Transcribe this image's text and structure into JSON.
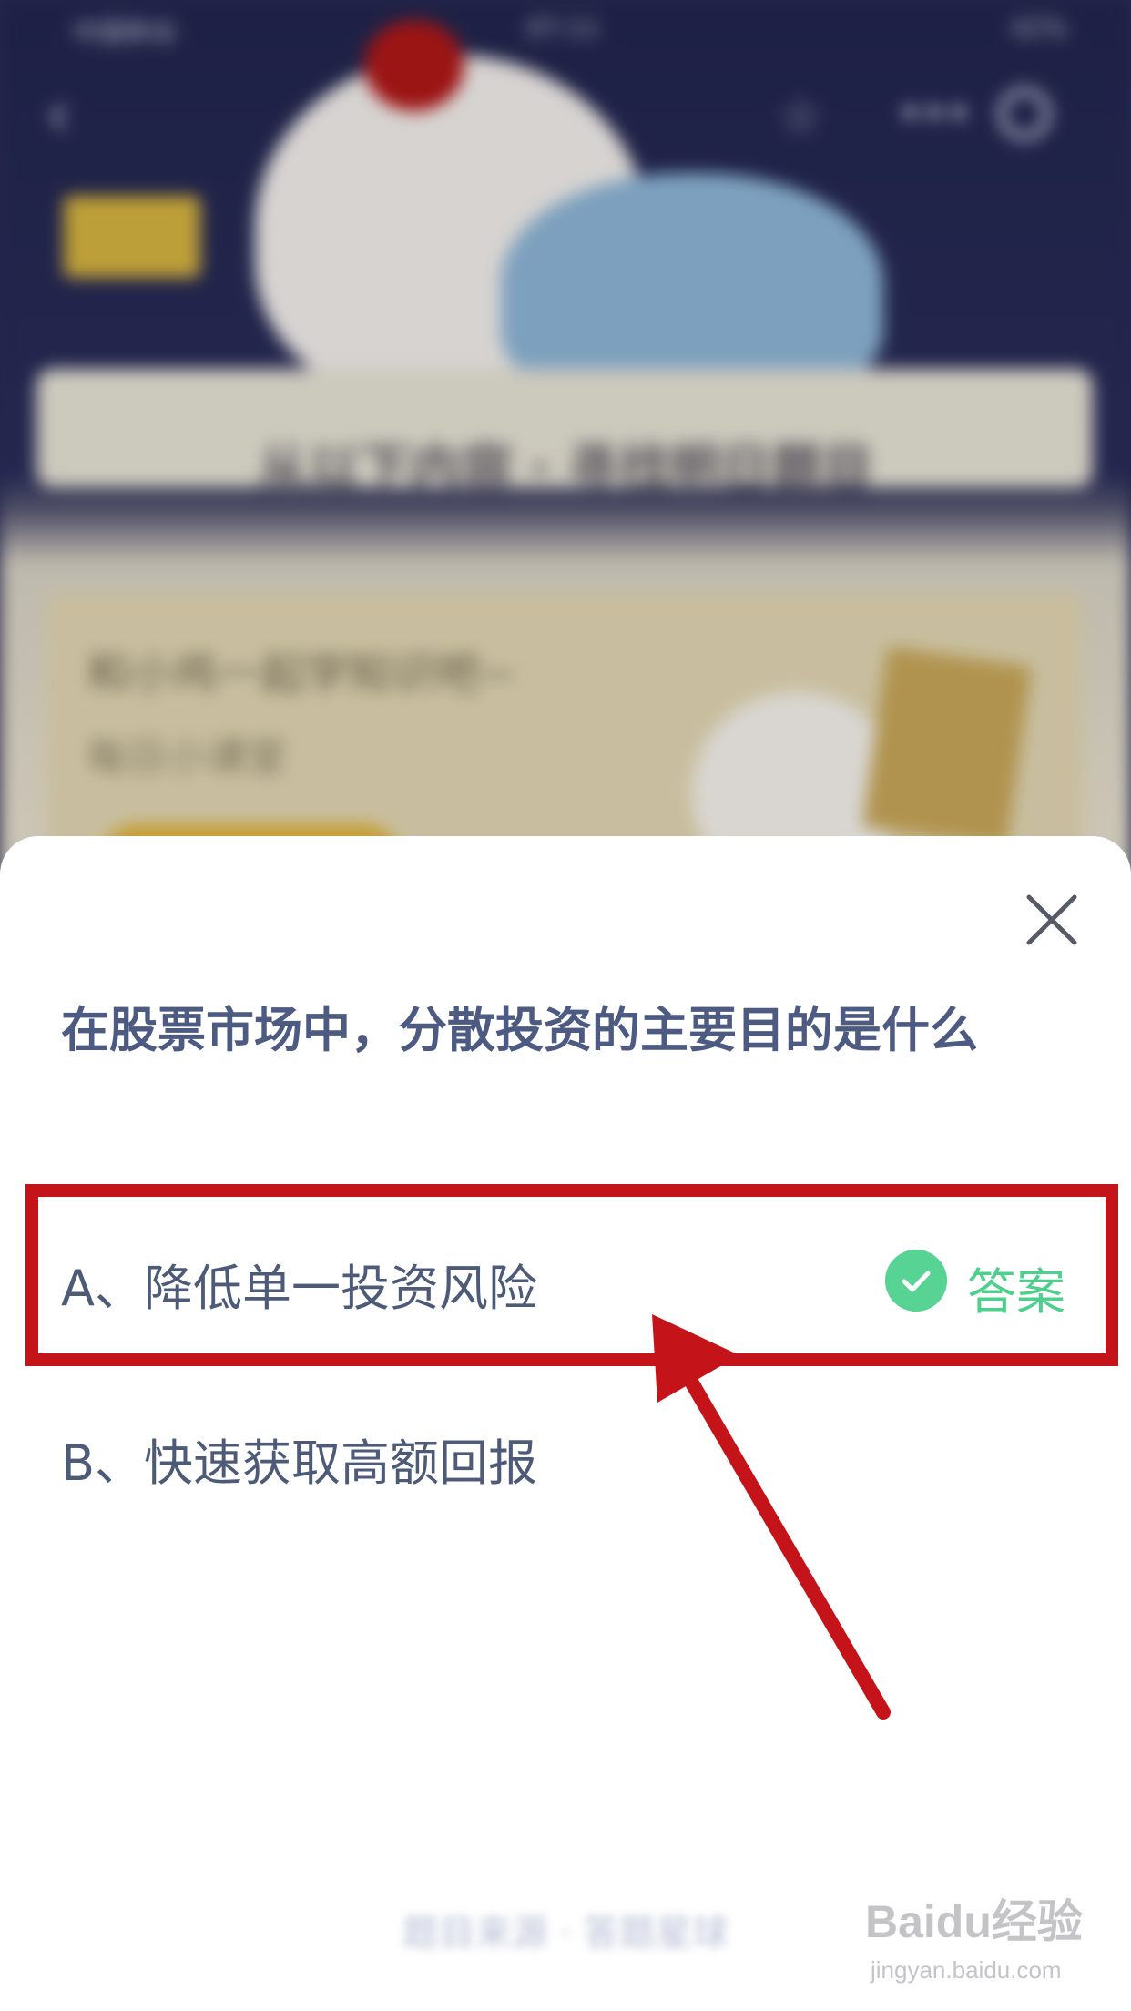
{
  "status_bar": {
    "carrier": "中国移动",
    "time": "07:11",
    "battery": "42%"
  },
  "banner": {
    "title": "从以下内容 · 寻找明日题目"
  },
  "card": {
    "line1": "和小鸡一起学知识吧~",
    "line2": "每日小课堂"
  },
  "quiz": {
    "question": "在股票市场中，分散投资的主要目的是什么",
    "options": [
      {
        "label": "A、降低单一投资风险",
        "is_answer": true
      },
      {
        "label": "B、快速获取高额回报",
        "is_answer": false
      }
    ],
    "answer_label": "答案"
  },
  "footer": {
    "link": "题目来源 · 答题星球"
  },
  "watermark": {
    "main": "Baidu经验",
    "sub": "jingyan.baidu.com"
  },
  "colors": {
    "highlight": "#c4141a",
    "answer_green": "#57d493",
    "question_text": "#4d5b82"
  }
}
